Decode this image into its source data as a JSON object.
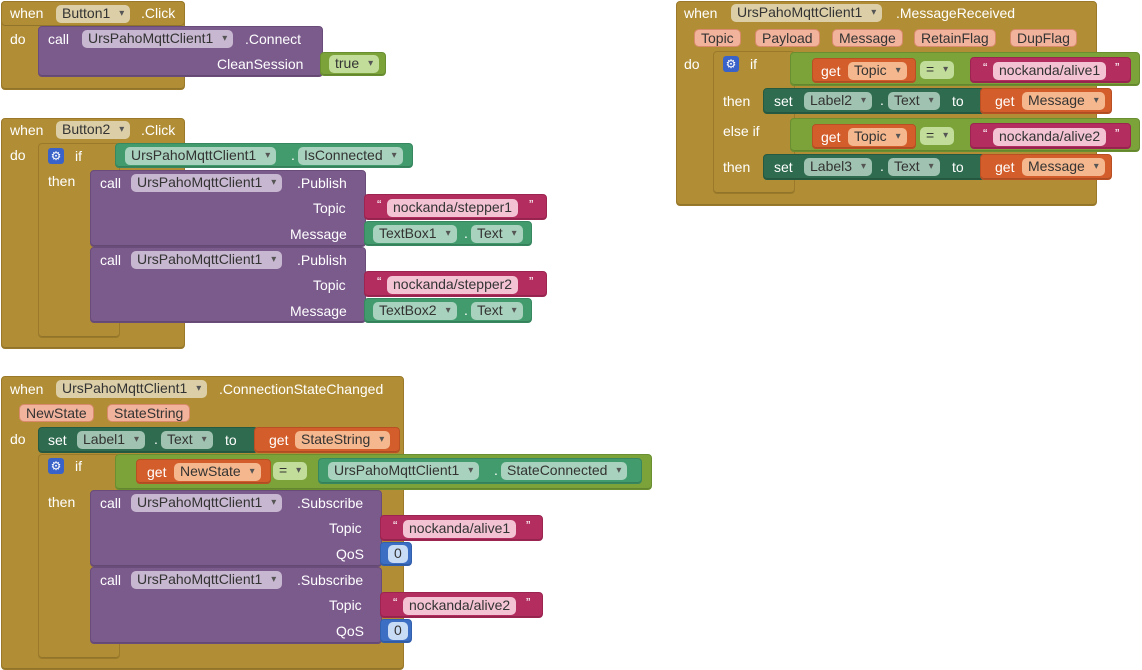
{
  "keywords": {
    "when": "when",
    "do": "do",
    "call": "call",
    "if": "if",
    "then": "then",
    "else_if": "else if",
    "set": "set",
    "to": "to",
    "get": "get",
    "dot": ".",
    "eq": "=",
    "quote_open": "“",
    "quote_close": "”"
  },
  "icons": {
    "mutator": "gear-icon",
    "dropdown": "chevron-down-icon"
  },
  "colors": {
    "event": "#b18e35",
    "procedure": "#7b5a8c",
    "logic": "#7ba33a",
    "text": "#b32d5e",
    "math": "#3c6fc4",
    "variable": "#d35e2b",
    "component": "#419b6d",
    "setter": "#2e6b4f"
  },
  "button1": {
    "component": "Button1",
    "event": ".Click",
    "call_component": "UrsPahoMqttClient1",
    "call_method": ".Connect",
    "param": "CleanSession",
    "value": "true"
  },
  "button2": {
    "component": "Button2",
    "event": ".Click",
    "cond_component": "UrsPahoMqttClient1",
    "cond_prop": "IsConnected",
    "publishes": [
      {
        "component": "UrsPahoMqttClient1",
        "method": ".Publish",
        "topic_label": "Topic",
        "topic": "nockanda/stepper1",
        "message_label": "Message",
        "msg_component": "TextBox1",
        "msg_prop": "Text"
      },
      {
        "component": "UrsPahoMqttClient1",
        "method": ".Publish",
        "topic_label": "Topic",
        "topic": "nockanda/stepper2",
        "message_label": "Message",
        "msg_component": "TextBox2",
        "msg_prop": "Text"
      }
    ]
  },
  "conn": {
    "component": "UrsPahoMqttClient1",
    "event": ".ConnectionStateChanged",
    "params": [
      "NewState",
      "StateString"
    ],
    "set_component": "Label1",
    "set_prop": "Text",
    "get_var": "StateString",
    "if_get_var": "NewState",
    "if_component": "UrsPahoMqttClient1",
    "if_prop": "StateConnected",
    "subscribes": [
      {
        "component": "UrsPahoMqttClient1",
        "method": ".Subscribe",
        "topic_label": "Topic",
        "topic": "nockanda/alive1",
        "qos_label": "QoS",
        "qos": "0"
      },
      {
        "component": "UrsPahoMqttClient1",
        "method": ".Subscribe",
        "topic_label": "Topic",
        "topic": "nockanda/alive2",
        "qos_label": "QoS",
        "qos": "0"
      }
    ]
  },
  "msg": {
    "component": "UrsPahoMqttClient1",
    "event": ".MessageReceived",
    "params": [
      "Topic",
      "Payload",
      "Message",
      "RetainFlag",
      "DupFlag"
    ],
    "branches": [
      {
        "get_var": "Topic",
        "topic": "nockanda/alive1",
        "set_component": "Label2",
        "set_prop": "Text",
        "value_var": "Message"
      },
      {
        "get_var": "Topic",
        "topic": "nockanda/alive2",
        "set_component": "Label3",
        "set_prop": "Text",
        "value_var": "Message"
      }
    ]
  }
}
